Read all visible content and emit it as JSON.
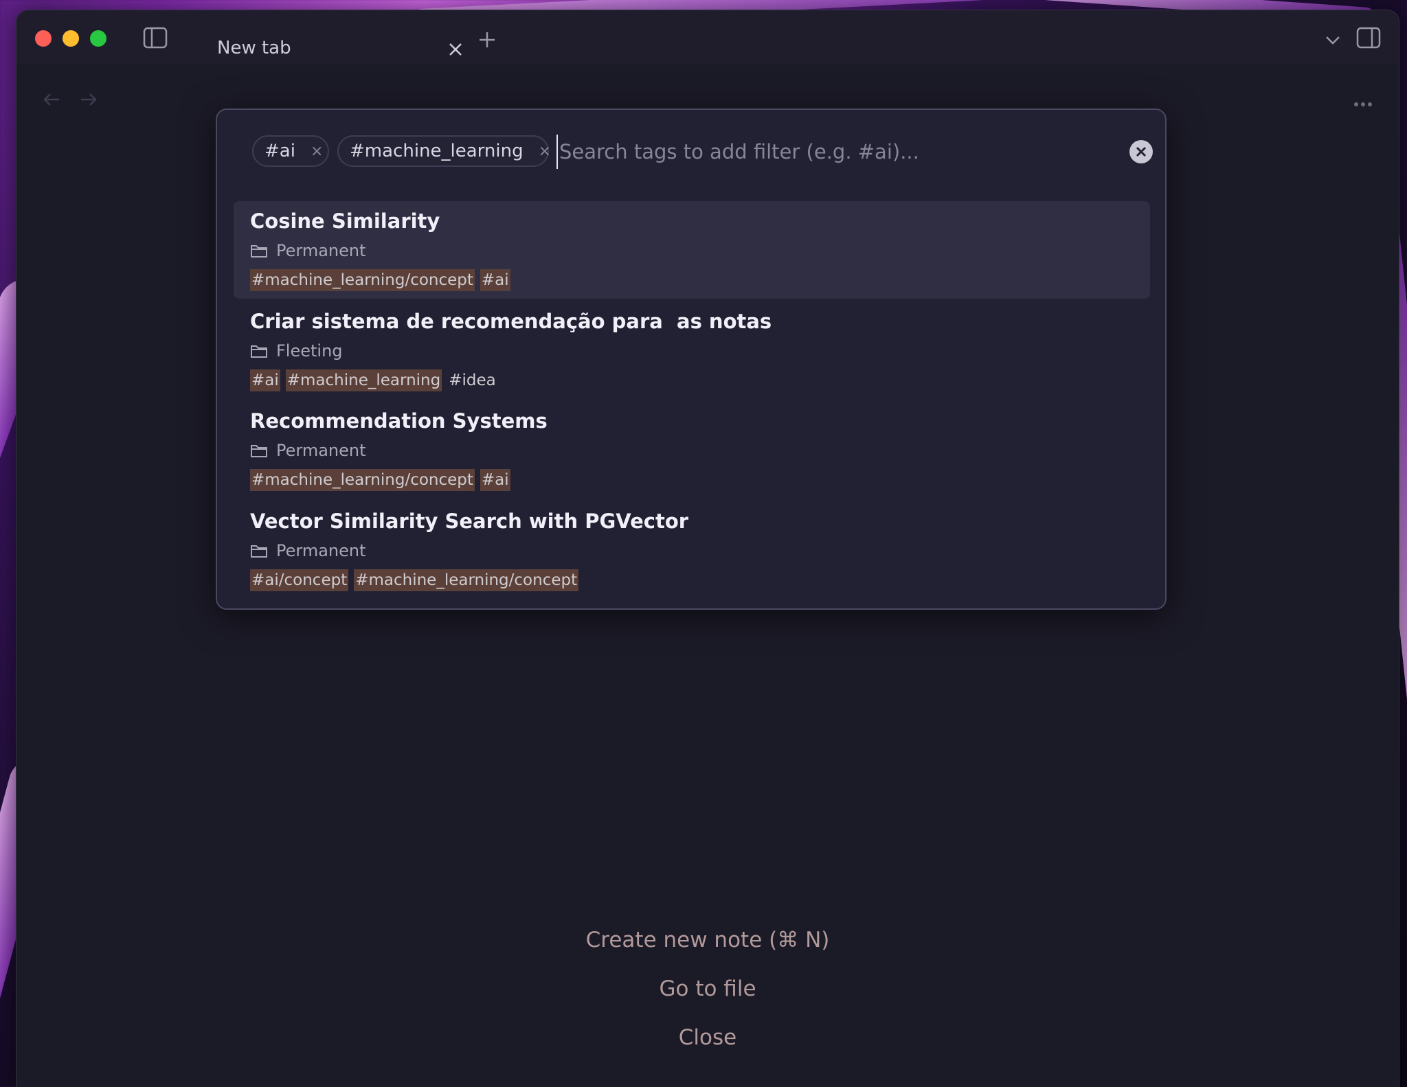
{
  "window": {
    "tab_title": "New tab"
  },
  "search": {
    "placeholder": "Search tags to add filter (e.g. #ai)...",
    "value": "",
    "active_filters": [
      {
        "label": "#ai",
        "remove_icon": "×"
      },
      {
        "label": "#machine_learning",
        "remove_icon": "×"
      }
    ]
  },
  "results": [
    {
      "title": "Cosine Similarity",
      "folder": "Permanent",
      "tags": [
        "#machine_learning/concept",
        "#ai"
      ],
      "selected": true
    },
    {
      "title": "Criar sistema de recomendação para  as notas",
      "folder": "Fleeting",
      "tags": [
        "#ai",
        "#machine_learning",
        "#idea"
      ],
      "selected": false
    },
    {
      "title": "Recommendation Systems",
      "folder": "Permanent",
      "tags": [
        "#machine_learning/concept",
        "#ai"
      ],
      "selected": false
    },
    {
      "title": "Vector Similarity Search with PGVector",
      "folder": "Permanent",
      "tags": [
        "#ai/concept",
        "#machine_learning/concept"
      ],
      "selected": false
    }
  ],
  "empty_state": {
    "create_note": "Create new note (⌘ N)",
    "go_to_file": "Go to file",
    "close": "Close"
  },
  "colors": {
    "window_bg": "#1b1a27",
    "modal_bg": "#222133",
    "selected_row": "#2f2e42",
    "tag_highlight": "#5a4038",
    "traffic_red": "#fe5f57",
    "traffic_yellow": "#febc2e",
    "traffic_green": "#28c840"
  }
}
